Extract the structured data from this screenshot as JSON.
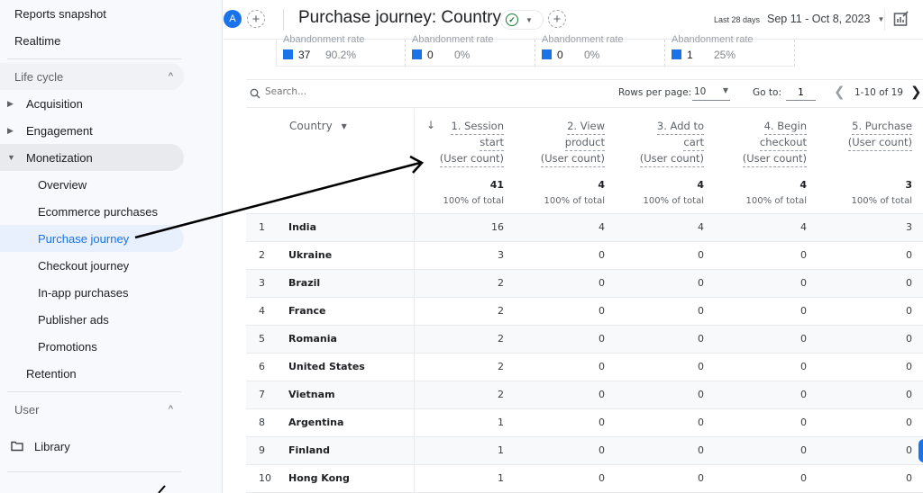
{
  "sidebar": {
    "top_items": [
      "Reports snapshot",
      "Realtime"
    ],
    "lifecycle_label": "Life cycle",
    "groups": [
      {
        "label": "Acquisition",
        "expanded": false
      },
      {
        "label": "Engagement",
        "expanded": false
      },
      {
        "label": "Monetization",
        "expanded": true
      },
      {
        "label": "Retention",
        "expanded": false
      }
    ],
    "monetization_items": [
      "Overview",
      "Ecommerce purchases",
      "Purchase journey",
      "Checkout journey",
      "In-app purchases",
      "Publisher ads",
      "Promotions"
    ],
    "active_item": "Purchase journey",
    "user_label": "User",
    "library_label": "Library"
  },
  "header": {
    "avatar_letter": "A",
    "title": "Purchase journey: Country",
    "date_label": "Last 28 days",
    "date_range": "Sep 11 - Oct 8, 2023"
  },
  "summary": {
    "cut_label": "Abandonment rate",
    "cards": [
      {
        "count": "37",
        "rate": "90.2%"
      },
      {
        "count": "0",
        "rate": "0%"
      },
      {
        "count": "0",
        "rate": "0%"
      },
      {
        "count": "1",
        "rate": "25%"
      }
    ]
  },
  "toolbar": {
    "search_placeholder": "Search...",
    "rows_per_page_label": "Rows per page:",
    "rows_per_page_value": "10",
    "goto_label": "Go to:",
    "goto_value": "1",
    "range_text": "1-10 of 19"
  },
  "table": {
    "dimension_header": "Country",
    "columns": [
      {
        "lines": [
          "1. Session",
          "start",
          "(User count)"
        ],
        "total": "41",
        "pct": "100% of total"
      },
      {
        "lines": [
          "2. View",
          "product",
          "(User count)"
        ],
        "total": "4",
        "pct": "100% of total"
      },
      {
        "lines": [
          "3. Add to",
          "cart",
          "(User count)"
        ],
        "total": "4",
        "pct": "100% of total"
      },
      {
        "lines": [
          "4. Begin",
          "checkout",
          "(User count)"
        ],
        "total": "4",
        "pct": "100% of total"
      },
      {
        "lines": [
          "5. Purchase",
          "(User count)"
        ],
        "total": "3",
        "pct": "100% of total"
      }
    ],
    "rows": [
      {
        "idx": "1",
        "country": "India",
        "values": [
          "16",
          "4",
          "4",
          "4",
          "3"
        ]
      },
      {
        "idx": "2",
        "country": "Ukraine",
        "values": [
          "3",
          "0",
          "0",
          "0",
          "0"
        ]
      },
      {
        "idx": "3",
        "country": "Brazil",
        "values": [
          "2",
          "0",
          "0",
          "0",
          "0"
        ]
      },
      {
        "idx": "4",
        "country": "France",
        "values": [
          "2",
          "0",
          "0",
          "0",
          "0"
        ]
      },
      {
        "idx": "5",
        "country": "Romania",
        "values": [
          "2",
          "0",
          "0",
          "0",
          "0"
        ]
      },
      {
        "idx": "6",
        "country": "United States",
        "values": [
          "2",
          "0",
          "0",
          "0",
          "0"
        ]
      },
      {
        "idx": "7",
        "country": "Vietnam",
        "values": [
          "2",
          "0",
          "0",
          "0",
          "0"
        ]
      },
      {
        "idx": "8",
        "country": "Argentina",
        "values": [
          "1",
          "0",
          "0",
          "0",
          "0"
        ]
      },
      {
        "idx": "9",
        "country": "Finland",
        "values": [
          "1",
          "0",
          "0",
          "0",
          "0"
        ]
      },
      {
        "idx": "10",
        "country": "Hong Kong",
        "values": [
          "1",
          "0",
          "0",
          "0",
          "0"
        ]
      }
    ]
  },
  "colors": {
    "accent": "#1a73e8",
    "success": "#188038",
    "annotation": "#000000"
  }
}
